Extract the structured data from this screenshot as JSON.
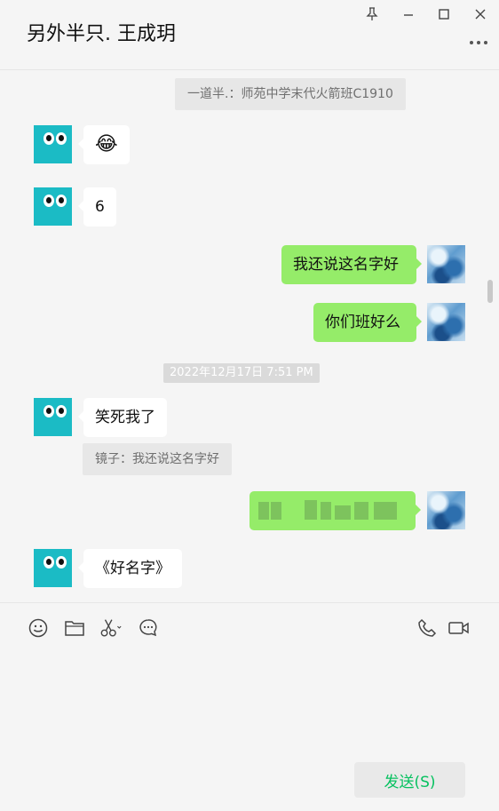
{
  "window": {
    "title": "另外半只. 王成玥",
    "controls": [
      "pin-icon",
      "minimize-icon",
      "maximize-icon",
      "close-icon"
    ]
  },
  "chat": {
    "quote_top": "一道半.：师苑中学末代火箭班C1910",
    "messages": [
      {
        "from": "contact",
        "type": "emoji",
        "text": "😂"
      },
      {
        "from": "contact",
        "type": "text",
        "text": "6"
      },
      {
        "from": "me",
        "type": "text",
        "text": "我还说这名字好"
      },
      {
        "from": "me",
        "type": "text",
        "text": "你们班好么"
      }
    ],
    "timestamp": "2022年12月17日 7:51 PM",
    "messages2": [
      {
        "from": "contact",
        "type": "text",
        "text": "笑死我了"
      }
    ],
    "quote_reply": "镜子：我还说这名字好",
    "messages3": [
      {
        "from": "me",
        "type": "blurred",
        "text": ""
      },
      {
        "from": "contact",
        "type": "text",
        "text": "《好名字》"
      }
    ]
  },
  "toolbar": {
    "left": [
      "emoji-icon",
      "folder-icon",
      "scissors-icon",
      "chat-bubble-icon"
    ],
    "right": [
      "phone-icon",
      "video-icon"
    ]
  },
  "composer": {
    "input_value": "",
    "send_label": "发送(S)"
  },
  "colors": {
    "outgoing_bubble": "#95ec69",
    "incoming_bubble": "#ffffff",
    "send_text": "#07c160",
    "contact_avatar": "#1bbbc5"
  }
}
